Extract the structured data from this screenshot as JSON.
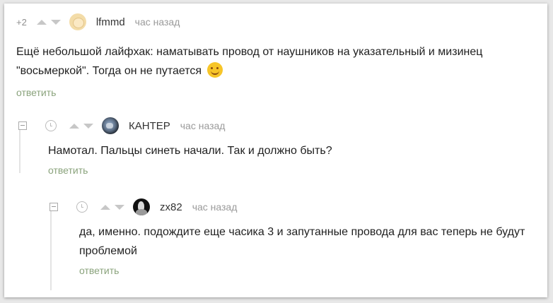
{
  "comments": [
    {
      "rating": "+2",
      "author": "lfmmd",
      "time": "час назад",
      "text": "Ещё небольшой лайфхак: наматывать провод от наушников на указательный и мизинец \"восьмеркой\". Тогда он не путается",
      "emoji": "smiling-face-icon",
      "reply": "ответить"
    },
    {
      "author": "КАНТЕР",
      "time": "час назад",
      "text": "Намотал. Пальцы синеть начали. Так и должно быть?",
      "reply": "ответить"
    },
    {
      "author": "zx82",
      "time": "час назад",
      "text": "да, именно. подождите еще часика 3 и запутанные провода для вас теперь не будут проблемой",
      "reply": "ответить"
    }
  ],
  "colors": {
    "reply_link": "#8aa37c",
    "meta": "#9a9a9a",
    "vote_arrow": "#c7c7c7"
  }
}
